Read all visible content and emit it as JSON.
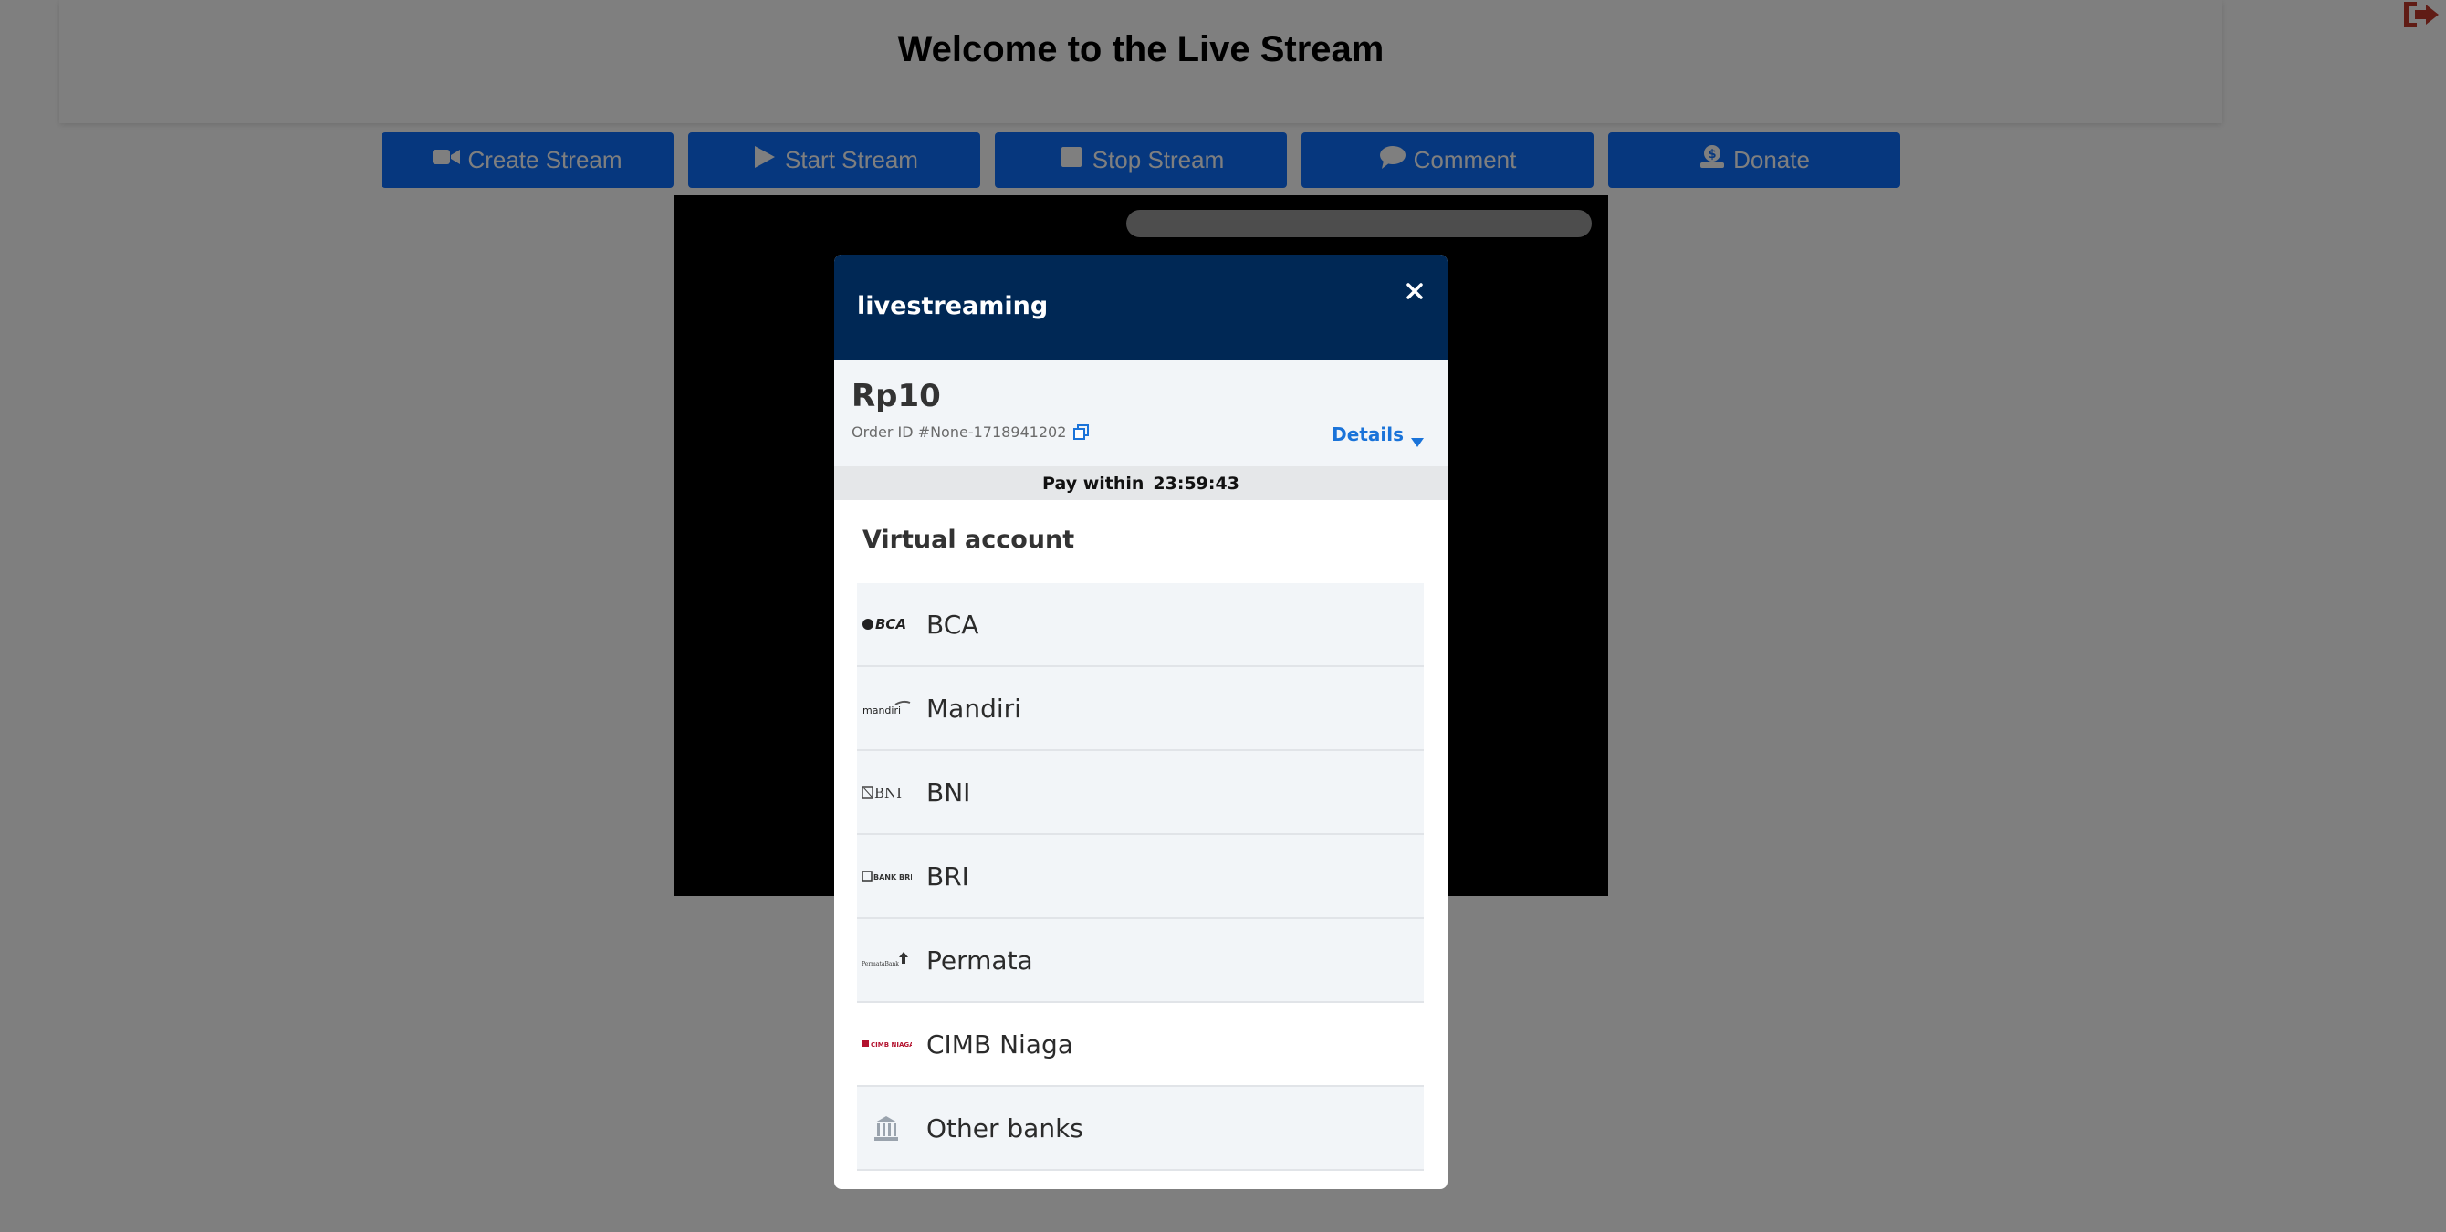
{
  "page": {
    "title": "Welcome to the Live Stream"
  },
  "toolbar": {
    "buttons": [
      {
        "label": "Create Stream",
        "icon": "video-camera-icon"
      },
      {
        "label": "Start Stream",
        "icon": "play-icon"
      },
      {
        "label": "Stop Stream",
        "icon": "stop-icon"
      },
      {
        "label": "Comment",
        "icon": "comment-icon"
      },
      {
        "label": "Donate",
        "icon": "donate-icon"
      }
    ]
  },
  "logout": {
    "icon": "sign-out-icon",
    "color": "#c0392b"
  },
  "modal": {
    "merchant": "livestreaming",
    "amount": "Rp10",
    "order_id": "Order ID #None-1718941202",
    "details_label": "Details",
    "pay_within_label": "Pay within",
    "countdown": "23:59:43",
    "section_title": "Virtual account",
    "banks": [
      {
        "name": "BCA",
        "logo": "bca-logo"
      },
      {
        "name": "Mandiri",
        "logo": "mandiri-logo"
      },
      {
        "name": "BNI",
        "logo": "bni-logo"
      },
      {
        "name": "BRI",
        "logo": "bri-logo"
      },
      {
        "name": "Permata",
        "logo": "permata-logo"
      },
      {
        "name": "CIMB Niaga",
        "logo": "cimb-niaga-logo"
      },
      {
        "name": "Other banks",
        "logo": "bank-building-icon"
      }
    ]
  },
  "colors": {
    "button": "#0d6efd",
    "modal_header": "#002855",
    "link": "#1a73d9"
  }
}
